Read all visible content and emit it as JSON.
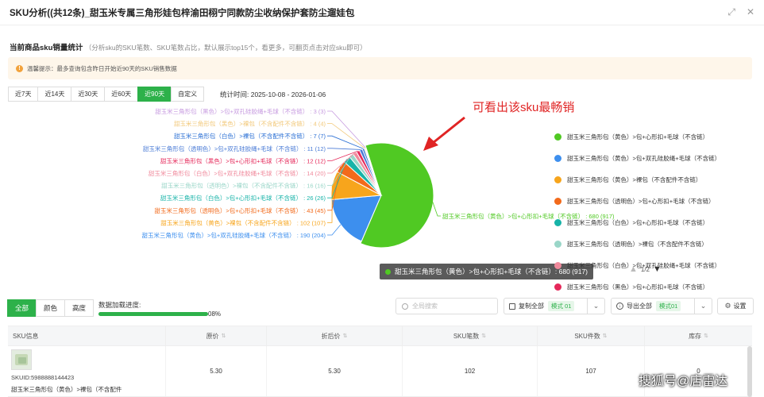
{
  "window": {
    "title": "SKU分析((共12条)_甜玉米专属三角形娃包梓渝田栩宁同款防尘收纳保护套防尘遛娃包"
  },
  "section": {
    "heading": "当前商品sku销量统计",
    "subheading": "（分析sku的SKU笔数、SKU笔数占比，默认展示top15个，看更多，可翻页点击对应sku即可）"
  },
  "notice": {
    "icon": "info-icon",
    "text": "温馨提示：最多查询包含昨日开始近90天的SKU销售数据"
  },
  "ranges": [
    {
      "label": "近7天",
      "active": false
    },
    {
      "label": "近14天",
      "active": false
    },
    {
      "label": "近30天",
      "active": false
    },
    {
      "label": "近60天",
      "active": false
    },
    {
      "label": "近90天",
      "active": true
    },
    {
      "label": "自定义",
      "active": false
    }
  ],
  "stat_time": "统计时间: 2025-10-08 - 2026-01-06",
  "annotation": "可看出该sku最畅销",
  "chart_data": {
    "type": "pie",
    "slices": [
      {
        "label": "甜玉米三角形包（黄色）>包+心形扣+毛球（不含链）",
        "value": 680,
        "total": 917,
        "color": "#50c923"
      },
      {
        "label": "甜玉米三角形包（黄色）>包+双孔硅胶绳+毛球（不含链）",
        "value": 190,
        "total": 204,
        "color": "#3d8fee"
      },
      {
        "label": "甜玉米三角形包（黄色）>裸包（不含配件不含链）",
        "value": 102,
        "total": 107,
        "color": "#f7a51c"
      },
      {
        "label": "甜玉米三角形包（透明色）>包+心形扣+毛球（不含链）",
        "value": 43,
        "total": 45,
        "color": "#f26a1b"
      },
      {
        "label": "甜玉米三角形包（白色）>包+心形扣+毛球（不含链）",
        "value": 26,
        "total": 26,
        "color": "#17b3a8"
      },
      {
        "label": "甜玉米三角形包（透明色）>裸包（不含配件不含链）",
        "value": 16,
        "total": 16,
        "color": "#9ad6c8"
      },
      {
        "label": "甜玉米三角形包（白色）>包+双孔硅胶绳+毛球（不含链）",
        "value": 14,
        "total": 20,
        "color": "#f08a9c"
      },
      {
        "label": "甜玉米三角形包（黑色）>包+心形扣+毛球（不含链）",
        "value": 12,
        "total": 12,
        "color": "#e5285a"
      },
      {
        "label": "甜玉米三角形包（透明色）>包+双孔硅胶绳+毛球（不含链）",
        "value": 11,
        "total": 12,
        "color": "#4a7bd6"
      },
      {
        "label": "甜玉米三角形包（白色）>裸包（不含配件不含链）",
        "value": 7,
        "total": 7,
        "color": "#2a6fd4"
      },
      {
        "label": "甜玉米三角形包（黑色）>裸包（不含配件不含链）",
        "value": 4,
        "total": 4,
        "color": "#f2c879"
      },
      {
        "label": "甜玉米三角形包（黑色）>包+双孔硅胶绳+毛球（不含链）",
        "value": 3,
        "total": 3,
        "color": "#c79be0"
      }
    ],
    "highlighted": 0,
    "legend_position": "right"
  },
  "tooltip": {
    "text": "甜玉米三角形包（黄色）>包+心形扣+毛球（不含链）: 680 (917)"
  },
  "legend": {
    "items": [
      {
        "label": "甜玉米三角形包（黄色）>包+心形扣+毛球（不含链）",
        "color": "#50c923"
      },
      {
        "label": "甜玉米三角形包（黄色）>包+双孔硅胶绳+毛球（不含链）",
        "color": "#3d8fee"
      },
      {
        "label": "甜玉米三角形包（黄色）>裸包（不含配件不含链）",
        "color": "#f7a51c"
      },
      {
        "label": "甜玉米三角形包（透明色）>包+心形扣+毛球（不含链）",
        "color": "#f26a1b"
      },
      {
        "label": "甜玉米三角形包（白色）>包+心形扣+毛球（不含链）",
        "color": "#17b3a8"
      },
      {
        "label": "甜玉米三角形包（透明色）>裸包（不含配件不含链）",
        "color": "#9ad6c8"
      },
      {
        "label": "甜玉米三角形包（白色）>包+双孔硅胶绳+毛球（不含链）",
        "color": "#f08a9c"
      },
      {
        "label": "甜玉米三角形包（黑色）>包+心形扣+毛球（不含链）",
        "color": "#e5285a"
      }
    ],
    "page": "1/2"
  },
  "filters": [
    {
      "label": "全部",
      "active": true
    },
    {
      "label": "颜色",
      "active": false
    },
    {
      "label": "高度",
      "active": false
    }
  ],
  "progress": {
    "label": "数据加载进度:",
    "percent": 100,
    "text": "08%"
  },
  "toolbar": {
    "search_placeholder": "全局搜索",
    "copy_label": "复制全部",
    "copy_mode": "模式 01",
    "export_label": "导出全部",
    "export_mode": "模式01",
    "settings_label": "设置"
  },
  "table": {
    "columns": [
      "SKU信息",
      "原价",
      "折后价",
      "SKU笔数",
      "SKU件数",
      "库存"
    ],
    "rows": [
      {
        "skuid": "SKUID:5988888144423",
        "name": "甜玉米三角形包（黄色）>裸包（不含配件",
        "price": "5.30",
        "discount": "5.30",
        "orders": "102",
        "pieces": "107",
        "stock": "0"
      }
    ]
  },
  "watermark": "搜狐号@店雷达"
}
